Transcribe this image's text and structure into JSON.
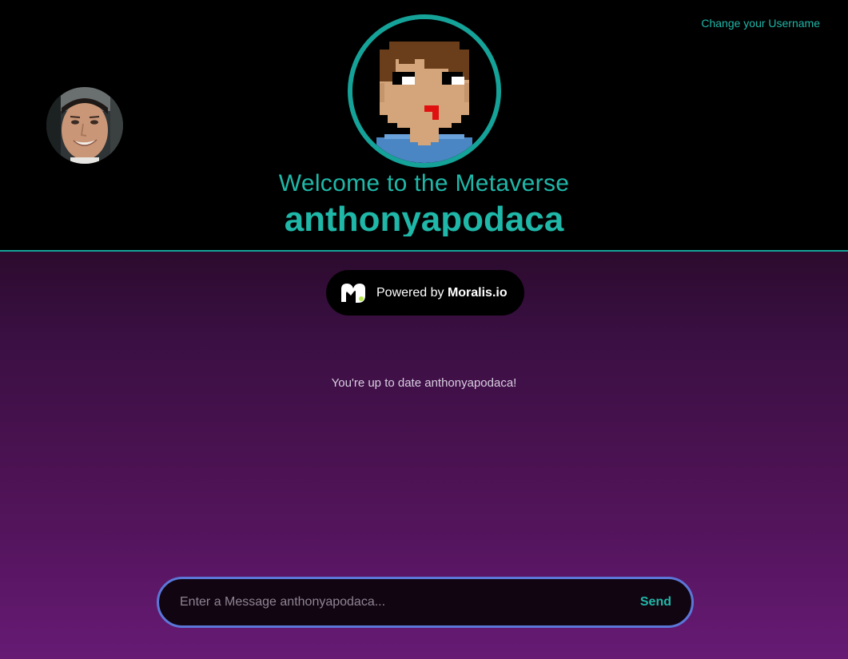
{
  "header": {
    "change_username_label": "Change your Username",
    "welcome_text": "Welcome to the Metaverse",
    "username": "anthonyapodaca",
    "profile_photo": "user-profile-photo",
    "avatar": "pixel-art-avatar"
  },
  "powered_badge": {
    "prefix": "Powered by ",
    "brand": "Moralis.io",
    "logo": "moralis-logo-icon"
  },
  "messages": {
    "status_text": "You're up to date anthonyapodaca!"
  },
  "composer": {
    "placeholder": "Enter a Message anthonyapodaca...",
    "value": "",
    "send_label": "Send"
  },
  "colors": {
    "accent": "#15a399",
    "header_bg": "#000000",
    "gradient_top": "#2c0b2e",
    "gradient_bottom": "#661a74",
    "input_border": "#5b77d8"
  }
}
